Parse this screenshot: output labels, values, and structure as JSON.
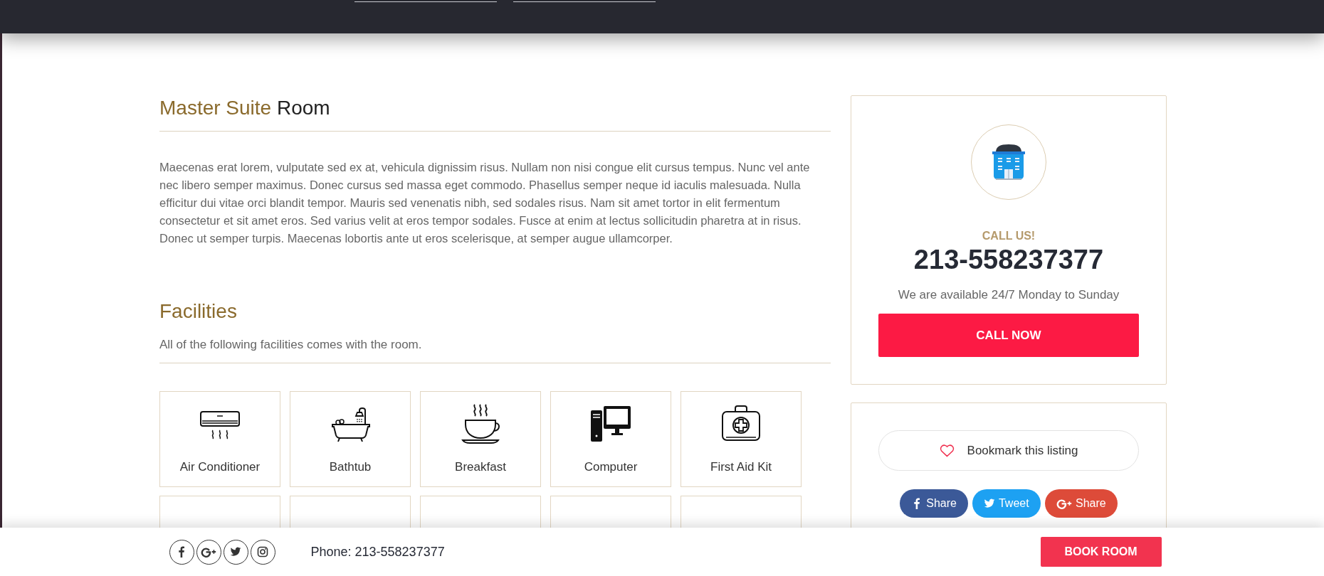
{
  "title": {
    "highlight": "Master Suite",
    "rest": "Room"
  },
  "description": "Maecenas erat lorem, vulputate sed ex at, vehicula dignissim risus. Nullam non nisi congue elit cursus tempus. Nunc vel ante nec libero semper maximus. Donec cursus sed massa eget commodo. Phasellus semper neque id iaculis malesuada. Nulla efficitur dui vitae orci blandit tempor. Mauris sed venenatis nibh, sed sodales risus. Nam sit amet tortor in elit fermentum consectetur et sit amet eros. Sed varius velit at eros tempor sodales. Fusce at enim at lectus sollicitudin pharetra at in risus. Donec ut semper turpis. Maecenas lobortis ante ut eros scelerisque, at semper augue ullamcorper.",
  "facilities": {
    "heading": "Facilities",
    "subtitle": "All of the following facilities comes with the room.",
    "items": [
      {
        "kind": "air-conditioner",
        "label": "Air Conditioner"
      },
      {
        "kind": "bathtub",
        "label": "Bathtub"
      },
      {
        "kind": "breakfast",
        "label": "Breakfast"
      },
      {
        "kind": "computer",
        "label": "Computer"
      },
      {
        "kind": "first-aid",
        "label": "First Aid Kit"
      },
      {
        "kind": "cut-off"
      },
      {
        "kind": "cut-off"
      },
      {
        "kind": "cut-off"
      },
      {
        "kind": "cut-off"
      },
      {
        "kind": "cut-off"
      }
    ]
  },
  "contact": {
    "label": "CALL US!",
    "phone": "213-558237377",
    "availability": "We are available 24/7 Monday to Sunday",
    "button": "CALL NOW"
  },
  "bookmark": {
    "label": "Bookmark this listing"
  },
  "share_buttons": [
    {
      "kind": "facebook",
      "label": "Share",
      "color": "#3b5998"
    },
    {
      "kind": "twitter",
      "label": "Tweet",
      "color": "#1da1f2"
    },
    {
      "kind": "google-plus",
      "label": "Share",
      "color": "#dd4b39"
    }
  ],
  "bottom_bar": {
    "social_links": [
      {
        "kind": "facebook"
      },
      {
        "kind": "google-plus"
      },
      {
        "kind": "twitter"
      },
      {
        "kind": "instagram"
      }
    ],
    "phone": "Phone: 213-558237377",
    "button": "BOOK ROOM"
  }
}
